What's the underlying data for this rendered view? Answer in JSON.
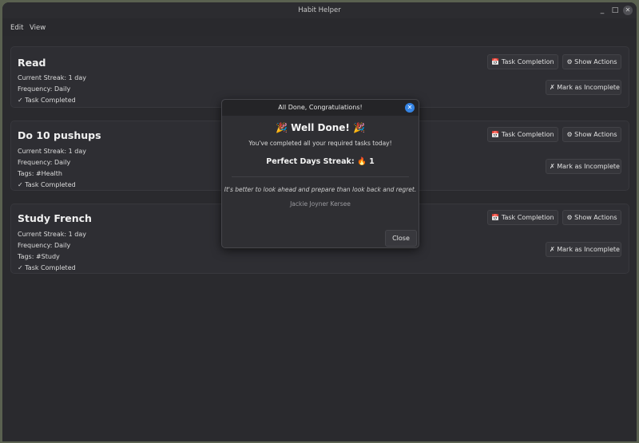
{
  "window": {
    "title": "Habit Helper",
    "minimize": "_",
    "maximize": "□",
    "close": "✕"
  },
  "menu": {
    "edit": "Edit",
    "view": "View"
  },
  "buttons": {
    "task_completion": "📅 Task Completion",
    "show_actions": "⚙ Show Actions",
    "mark_incomplete": "✗ Mark as Incomplete"
  },
  "habits": [
    {
      "name": "Read",
      "streak": "Current Streak: 1 day",
      "frequency": "Frequency: Daily",
      "tags": "",
      "status": "✓ Task Completed"
    },
    {
      "name": "Do 10 pushups",
      "streak": "Current Streak: 1 day",
      "frequency": "Frequency: Daily",
      "tags": "Tags:  #Health",
      "status": "✓ Task Completed"
    },
    {
      "name": "Study French",
      "streak": "Current Streak: 1 day",
      "frequency": "Frequency: Daily",
      "tags": "Tags:  #Study",
      "status": "✓ Task Completed"
    }
  ],
  "dialog": {
    "title": "All Done, Congratulations!",
    "heading": "🎉 Well Done! 🎉",
    "message": "You've completed all your required tasks today!",
    "streak": "Perfect Days Streak: 🔥 1",
    "quote": "It's better to look ahead and prepare than look back and regret.",
    "author": "Jackie Joyner Kersee",
    "close_label": "Close",
    "close_icon": "✕"
  }
}
